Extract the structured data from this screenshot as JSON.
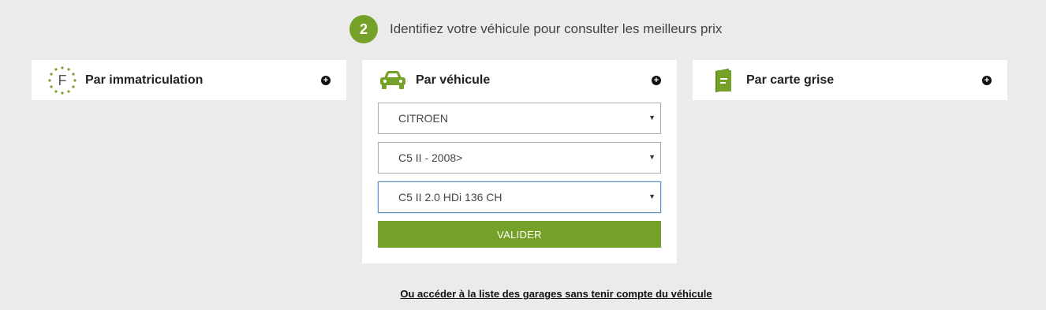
{
  "step": {
    "number": "2",
    "title": "Identifiez votre véhicule pour consulter les meilleurs prix"
  },
  "cards": {
    "immatriculation": {
      "title": "Par immatriculation",
      "plate_letter": "F"
    },
    "vehicule": {
      "title": "Par véhicule",
      "selects": [
        {
          "value": "CITROEN"
        },
        {
          "value": "C5 II - 2008>"
        },
        {
          "value": "C5 II 2.0 HDi 136 CH"
        }
      ],
      "submit_label": "VALIDER"
    },
    "carte_grise": {
      "title": "Par carte grise"
    }
  },
  "footer_link": "Ou accéder à la liste des garages sans tenir compte du véhicule",
  "colors": {
    "accent": "#76a128",
    "background": "#ebebeb"
  },
  "icons": [
    "eu-plate-icon",
    "car-icon",
    "registration-card-icon",
    "plus-circle-icon",
    "caret-down-icon"
  ]
}
